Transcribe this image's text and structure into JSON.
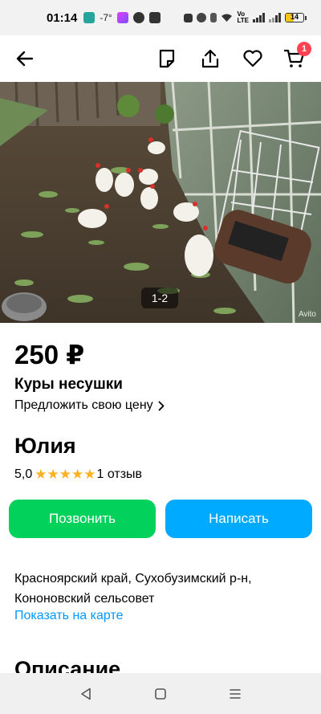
{
  "status_bar": {
    "time": "01:14",
    "weather": "-7°",
    "battery": "14"
  },
  "toolbar": {
    "cart_count": "1"
  },
  "photo": {
    "counter": "1-2",
    "watermark": "Avito"
  },
  "listing": {
    "price": "250 ₽",
    "title": "Куры несушки",
    "offer_price_label": "Предложить свою цену"
  },
  "seller": {
    "name": "Юлия",
    "rating": "5,0",
    "stars": 5,
    "reviews": "1 отзыв"
  },
  "actions": {
    "call_label": "Позвонить",
    "write_label": "Написать"
  },
  "location": {
    "address": "Красноярский край, Сухобузимский р-н, Кононовский сельсовет",
    "map_link": "Показать на карте"
  },
  "description": {
    "heading": "Описание"
  },
  "colors": {
    "call_button": "#02d15c",
    "write_button": "#00aaff",
    "link": "#0099ff",
    "star": "#ffb021",
    "badge": "#ff4053"
  }
}
